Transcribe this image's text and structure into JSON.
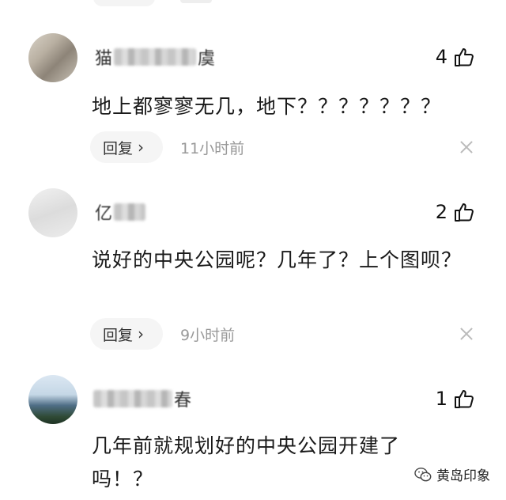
{
  "comments": [
    {
      "username_visible": [
        "猫",
        "虞"
      ],
      "likes": "4",
      "text": "地上都寥寥无几，地下？？？？？？？",
      "reply_label": "回复",
      "time": "11小时前"
    },
    {
      "username_visible": [
        "亿"
      ],
      "likes": "2",
      "text": "说好的中央公园呢？几年了？上个图呗？",
      "reply_label": "回复",
      "time": "9小时前"
    },
    {
      "username_visible": [
        "春"
      ],
      "likes": "1",
      "text": "几年前就规划好的中央公园开建了吗！？",
      "reply_label": "回复",
      "time": ""
    }
  ],
  "watermark": {
    "text": "黄岛印象",
    "icon": "wechat-icon"
  },
  "icons": {
    "like": "thumbs-up-icon",
    "dismiss": "close-icon",
    "reply_chevron": "chevron-right-icon"
  }
}
